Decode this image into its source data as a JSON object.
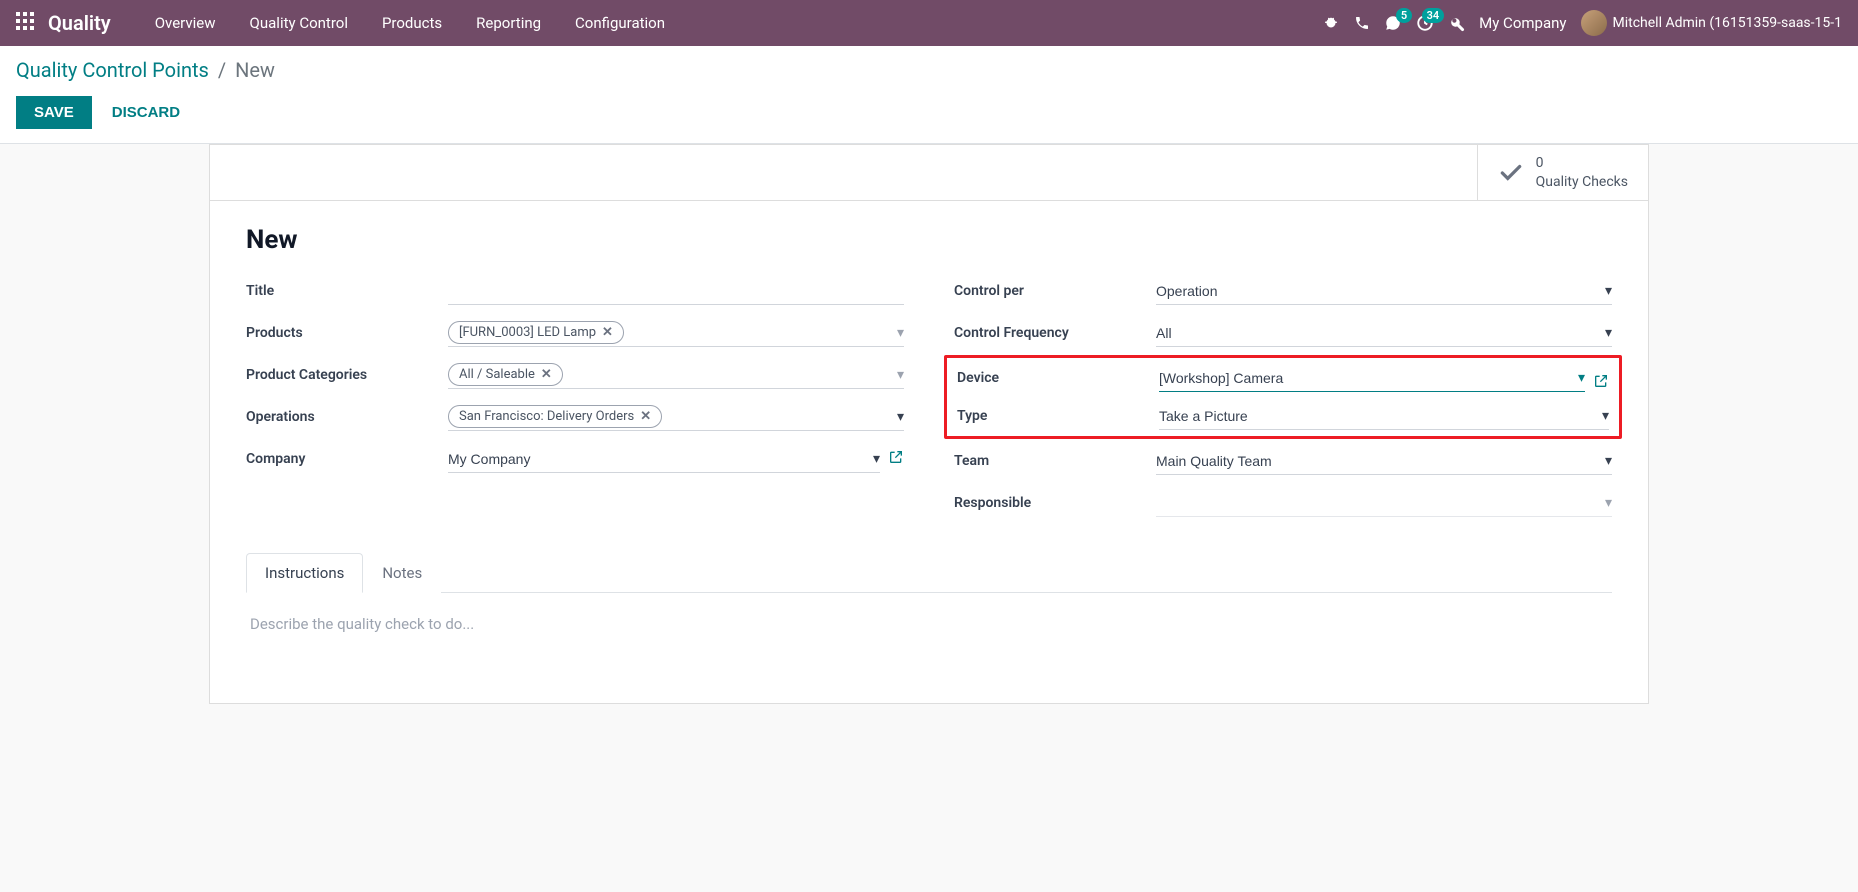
{
  "navbar": {
    "app_title": "Quality",
    "menu": [
      "Overview",
      "Quality Control",
      "Products",
      "Reporting",
      "Configuration"
    ],
    "messages_badge": "5",
    "activities_badge": "34",
    "company": "My Company",
    "user": "Mitchell Admin (16151359-saas-15-1"
  },
  "control_panel": {
    "breadcrumb_root": "Quality Control Points",
    "breadcrumb_current": "New",
    "save": "SAVE",
    "discard": "DISCARD"
  },
  "stat": {
    "count": "0",
    "label": "Quality Checks"
  },
  "record": {
    "title": "New"
  },
  "left": {
    "title": {
      "label": "Title",
      "value": ""
    },
    "products": {
      "label": "Products",
      "tag": "[FURN_0003] LED Lamp"
    },
    "categories": {
      "label": "Product Categories",
      "tag": "All / Saleable"
    },
    "operations": {
      "label": "Operations",
      "tag": "San Francisco: Delivery Orders"
    },
    "company": {
      "label": "Company",
      "value": "My Company"
    }
  },
  "right": {
    "control_per": {
      "label": "Control per",
      "value": "Operation"
    },
    "control_freq": {
      "label": "Control Frequency",
      "value": "All"
    },
    "device": {
      "label": "Device",
      "value": "[Workshop] Camera"
    },
    "type": {
      "label": "Type",
      "value": "Take a Picture"
    },
    "team": {
      "label": "Team",
      "value": "Main Quality Team"
    },
    "responsible": {
      "label": "Responsible",
      "value": ""
    }
  },
  "tabs": {
    "instructions": "Instructions",
    "notes": "Notes",
    "placeholder": "Describe the quality check to do..."
  }
}
